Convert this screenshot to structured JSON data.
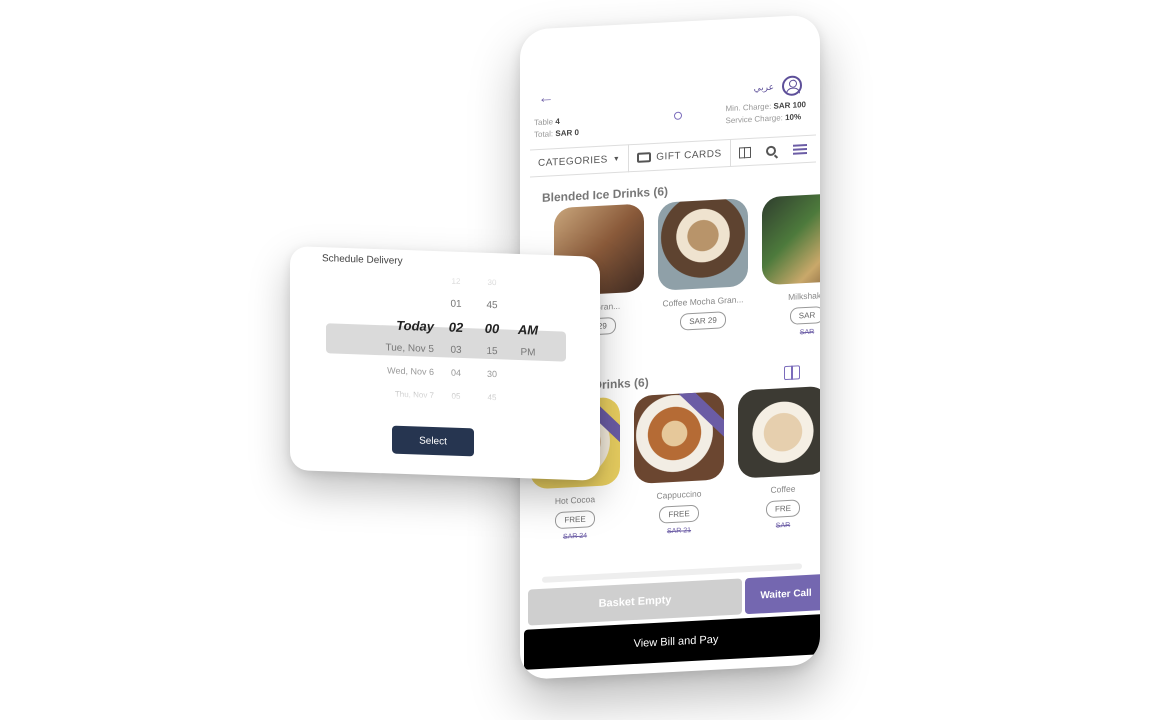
{
  "phone": {
    "header": {
      "back_icon": "arrow-left-icon",
      "language": "عربي",
      "profile_icon": "user-circle-icon"
    },
    "info": {
      "table_label": "Table",
      "table_value": "4",
      "total_label": "Total",
      "total_value": "SAR 0",
      "min_charge_label": "Min. Charge:",
      "min_charge_value": "SAR 100",
      "service_charge_label": "Service Charge:",
      "service_charge_value": "10%"
    },
    "tabs": {
      "categories": "CATEGORIES",
      "gift_cards": "GIFT CARDS"
    },
    "sections": [
      {
        "title": "Blended Ice Drinks (6)",
        "items": [
          {
            "name": "...te Gran...",
            "price": "...29"
          },
          {
            "name": "Coffee Mocha Gran...",
            "price": "SAR 29"
          },
          {
            "name": "Milkshake",
            "price": "SAR",
            "old_price": "SAR"
          }
        ]
      },
      {
        "title": "... Drinks (6)",
        "items": [
          {
            "name": "Hot Cocoa",
            "price": "FREE",
            "old_price": "SAR 24"
          },
          {
            "name": "Cappuccino",
            "price": "FREE",
            "old_price": "SAR 21"
          },
          {
            "name": "Coffee",
            "price": "FRE",
            "old_price": "SAR"
          }
        ]
      }
    ],
    "buttons": {
      "basket": "Basket Empty",
      "waiter": "Waiter Call",
      "bill": "View Bill and Pay"
    }
  },
  "schedule": {
    "title": "Schedule Delivery",
    "dates": [
      "",
      "",
      "Today",
      "Tue, Nov 5",
      "Wed, Nov 6",
      "Thu, Nov 7"
    ],
    "hours": [
      "..",
      "12",
      "01",
      "02",
      "03",
      "04",
      "05"
    ],
    "minutes": [
      "15",
      "30",
      "45",
      "00",
      "15",
      "30",
      "45"
    ],
    "ampm": [
      "",
      "",
      "",
      "AM",
      "PM",
      "",
      ""
    ],
    "select_label": "Select"
  }
}
